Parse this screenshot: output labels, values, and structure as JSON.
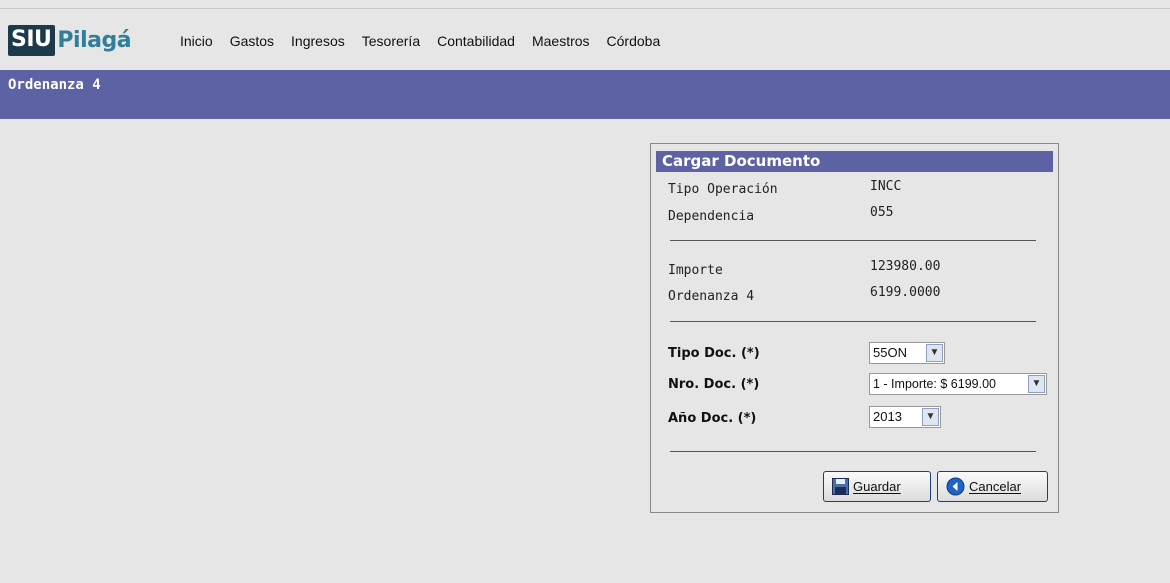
{
  "app": {
    "logo_siu": "SIU",
    "logo_pilaga": "Pilagá"
  },
  "menu": [
    "Inicio",
    "Gastos",
    "Ingresos",
    "Tesorería",
    "Contabilidad",
    "Maestros",
    "Córdoba"
  ],
  "page_title": "Ordenanza 4",
  "panel": {
    "title": "Cargar Documento",
    "tipo_operacion_label": "Tipo Operación",
    "tipo_operacion_value": "INCC",
    "dependencia_label": "Dependencia",
    "dependencia_value": "055",
    "importe_label": "Importe",
    "importe_value": "123980.00",
    "ordenanza_label": "Ordenanza 4",
    "ordenanza_value": "6199.0000",
    "tipo_doc_label": "Tipo Doc. (*)",
    "tipo_doc_value": "55ON",
    "nro_doc_label": "Nro. Doc. (*)",
    "nro_doc_value": "1 - Importe: $ 6199.00",
    "anio_doc_label": "Año Doc. (*)",
    "anio_doc_value": "2013",
    "guardar_label": "Guardar",
    "cancelar_label": "Cancelar"
  },
  "colors": {
    "title_bar": "#5d62a4",
    "background": "#e6e6e6",
    "logo_dark": "#1d3a4c",
    "logo_accent": "#2f7f9a"
  },
  "icons": {
    "dropdown": "chevron-down-icon",
    "save": "floppy-disk-icon",
    "cancel": "back-arrow-circle-icon"
  }
}
